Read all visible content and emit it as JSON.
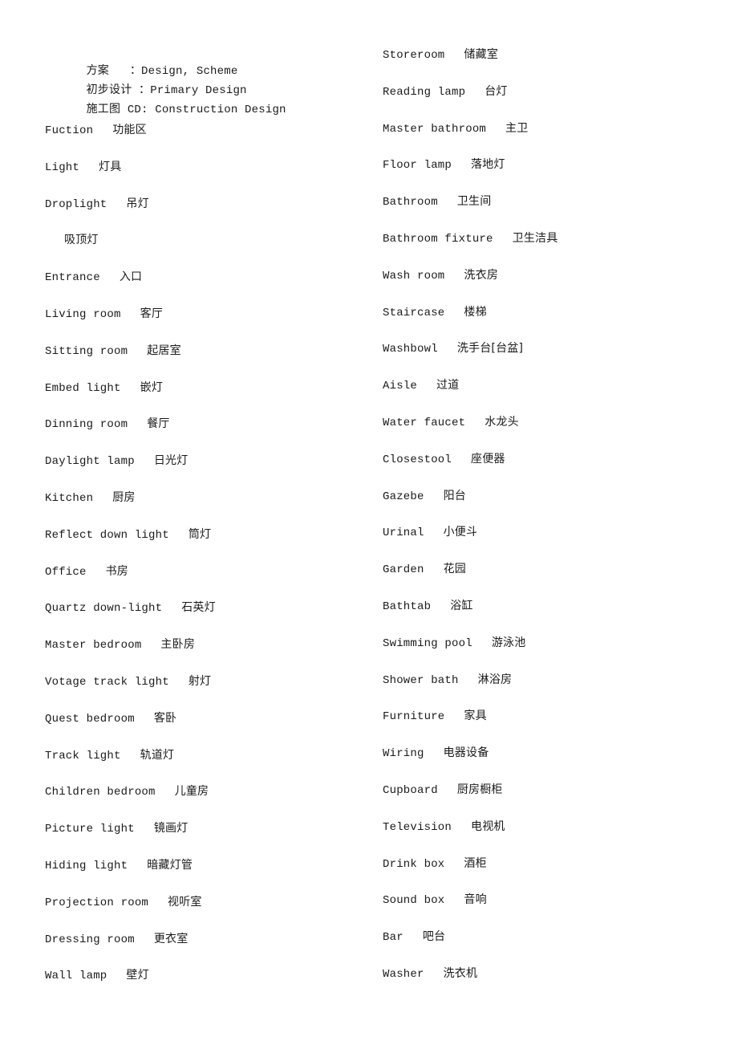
{
  "header": {
    "lines": [
      {
        "zh": "方案",
        "sep": "   ：",
        "en": "Design, Scheme"
      },
      {
        "zh": "初步设计",
        "sep": " ：",
        "en": "Primary Design"
      },
      {
        "zh": "施工图",
        "sep": " CD: ",
        "en": "Construction Design"
      }
    ]
  },
  "left_column": [
    {
      "en": "Fuction",
      "zh": "功能区"
    },
    {
      "en": "Light",
      "zh": "灯具"
    },
    {
      "en": "Droplight",
      "zh": "吊灯"
    },
    {
      "en": "",
      "zh": "吸顶灯"
    },
    {
      "en": "Entrance",
      "zh": "入口"
    },
    {
      "en": "Living room",
      "zh": "客厅"
    },
    {
      "en": "Sitting room",
      "zh": "起居室"
    },
    {
      "en": "Embed light",
      "zh": "嵌灯"
    },
    {
      "en": "Dinning room",
      "zh": "餐厅"
    },
    {
      "en": "Daylight lamp",
      "zh": "日光灯"
    },
    {
      "en": "Kitchen",
      "zh": "厨房"
    },
    {
      "en": "Reflect down light",
      "zh": "筒灯"
    },
    {
      "en": "Office",
      "zh": "书房"
    },
    {
      "en": "Quartz down-light",
      "zh": "石英灯"
    },
    {
      "en": "Master bedroom",
      "zh": "主卧房"
    },
    {
      "en": "Votage track light",
      "zh": "射灯"
    },
    {
      "en": "Quest bedroom",
      "zh": "客卧"
    },
    {
      "en": "Track light",
      "zh": "轨道灯"
    },
    {
      "en": "Children bedroom",
      "zh": "儿童房"
    },
    {
      "en": "Picture light",
      "zh": "镜画灯"
    },
    {
      "en": "Hiding light",
      "zh": "暗藏灯管"
    },
    {
      "en": "Projection room",
      "zh": "视听室"
    },
    {
      "en": "Dressing room",
      "zh": "更衣室"
    },
    {
      "en": "Wall lamp",
      "zh": "壁灯"
    }
  ],
  "right_column": [
    {
      "en": "Storeroom",
      "zh": "储藏室"
    },
    {
      "en": "Reading lamp",
      "zh": "台灯"
    },
    {
      "en": "Master bathroom",
      "zh": "主卫"
    },
    {
      "en": "Floor lamp",
      "zh": "落地灯"
    },
    {
      "en": "Bathroom",
      "zh": "卫生间"
    },
    {
      "en": "Bathroom fixture",
      "zh": "卫生洁具"
    },
    {
      "en": "Wash room",
      "zh": "洗衣房"
    },
    {
      "en": "Staircase",
      "zh": "楼梯"
    },
    {
      "en": "Washbowl",
      "zh": "洗手台[台盆]"
    },
    {
      "en": "Aisle",
      "zh": "过道"
    },
    {
      "en": "Water faucet",
      "zh": "水龙头"
    },
    {
      "en": "Closestool",
      "zh": "座便器"
    },
    {
      "en": "Gazebe",
      "zh": "阳台"
    },
    {
      "en": "Urinal",
      "zh": "小便斗"
    },
    {
      "en": "Garden",
      "zh": "花园"
    },
    {
      "en": "Bathtab",
      "zh": "浴缸"
    },
    {
      "en": "Swimming pool",
      "zh": "游泳池"
    },
    {
      "en": "Shower bath",
      "zh": "淋浴房"
    },
    {
      "en": "Furniture",
      "zh": "家具"
    },
    {
      "en": "Wiring",
      "zh": "电器设备"
    },
    {
      "en": "Cupboard",
      "zh": "厨房橱柜"
    },
    {
      "en": "Television",
      "zh": "电视机"
    },
    {
      "en": "Drink box",
      "zh": "酒柜"
    },
    {
      "en": "Sound box",
      "zh": "音响"
    },
    {
      "en": "Bar",
      "zh": "吧台"
    },
    {
      "en": "Washer",
      "zh": "洗衣机"
    }
  ]
}
